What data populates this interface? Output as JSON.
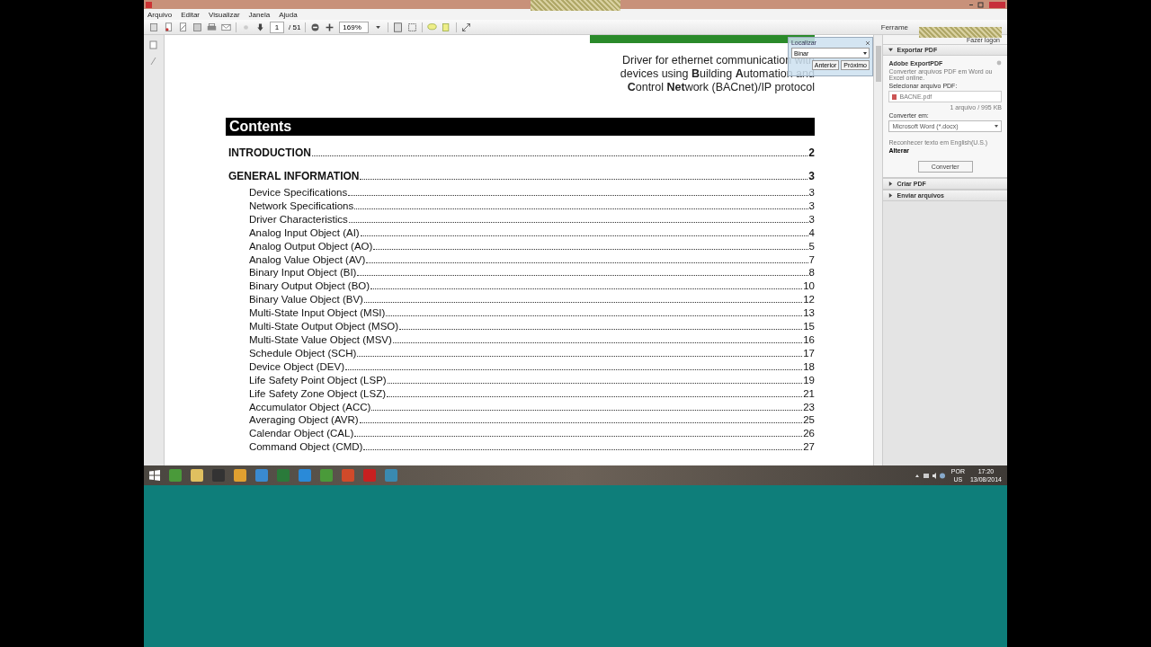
{
  "window": {
    "menu": [
      "Arquivo",
      "Editar",
      "Visualizar",
      "Janela",
      "Ajuda"
    ]
  },
  "toolbar": {
    "page": "1",
    "page_count": "/ 51",
    "zoom": "169%",
    "right_tab": "Ferrame"
  },
  "document": {
    "intro_lines": [
      "Driver for ethernet communication with",
      "devices using **B**uilding **A**utomation and",
      "**C**ontrol **Net**work (BACnet)/IP protocol"
    ],
    "contents_title": "Contents",
    "entries": [
      {
        "kind": "section",
        "title": "INTRODUCTION",
        "page": "2"
      },
      {
        "kind": "section",
        "title": "GENERAL INFORMATION",
        "page": "3"
      },
      {
        "kind": "item",
        "title": "Device Specifications",
        "page": "3"
      },
      {
        "kind": "item",
        "title": "Network Specifications",
        "page": "3"
      },
      {
        "kind": "item",
        "title": "Driver Characteristics",
        "page": "3"
      },
      {
        "kind": "item",
        "title": "Analog Input Object (AI)",
        "page": "4"
      },
      {
        "kind": "item",
        "title": "Analog Output Object (AO)",
        "page": "5"
      },
      {
        "kind": "item",
        "title": "Analog Value Object (AV)",
        "page": "7"
      },
      {
        "kind": "item",
        "title": "Binary Input Object (BI)",
        "page": "8"
      },
      {
        "kind": "item",
        "title": "Binary Output Object (BO)",
        "page": "10"
      },
      {
        "kind": "item",
        "title": "Binary Value Object (BV)",
        "page": "12"
      },
      {
        "kind": "item",
        "title": "Multi-State Input Object (MSI)",
        "page": "13"
      },
      {
        "kind": "item",
        "title": "Multi-State Output Object (MSO)",
        "page": "15"
      },
      {
        "kind": "item",
        "title": "Multi-State Value Object (MSV)",
        "page": "16"
      },
      {
        "kind": "item",
        "title": "Schedule Object (SCH)",
        "page": "17"
      },
      {
        "kind": "item",
        "title": "Device Object (DEV)",
        "page": "18"
      },
      {
        "kind": "item",
        "title": "Life Safety Point Object (LSP)",
        "page": "19"
      },
      {
        "kind": "item",
        "title": "Life Safety Zone Object (LSZ)",
        "page": "21"
      },
      {
        "kind": "item",
        "title": "Accumulator Object (ACC)",
        "page": "23"
      },
      {
        "kind": "item",
        "title": "Averaging Object (AVR)",
        "page": "25"
      },
      {
        "kind": "item",
        "title": "Calendar Object (CAL)",
        "page": "26"
      },
      {
        "kind": "item",
        "title": "Command Object (CMD)",
        "page": "27"
      }
    ]
  },
  "find_bar": {
    "title": "Localizar",
    "query": "Binar",
    "buttons": [
      "Anterior",
      "Próximo"
    ]
  },
  "side_panel": {
    "login": "Fazer logon",
    "sections": [
      {
        "title": "Exportar PDF",
        "expanded": true
      },
      {
        "title": "Criar PDF",
        "expanded": false
      },
      {
        "title": "Enviar arquivos",
        "expanded": false
      }
    ],
    "export": {
      "heading": "Adobe ExportPDF",
      "description": "Converter arquivos PDF em Word ou Excel online.",
      "select_label": "Selecionar arquivo PDF:",
      "file": "BACNE.pdf",
      "file_info": "1 arquivo / 995 KB",
      "convert_label": "Converter em:",
      "format": "Microsoft Word (*.docx)",
      "ocr_text": "Reconhecer texto em English(U.S.)",
      "ocr_link": "Alterar",
      "button": "Converter"
    }
  },
  "taskbar": {
    "language": "POR",
    "layout": "US",
    "time": "17:20",
    "date": "13/08/2014"
  }
}
